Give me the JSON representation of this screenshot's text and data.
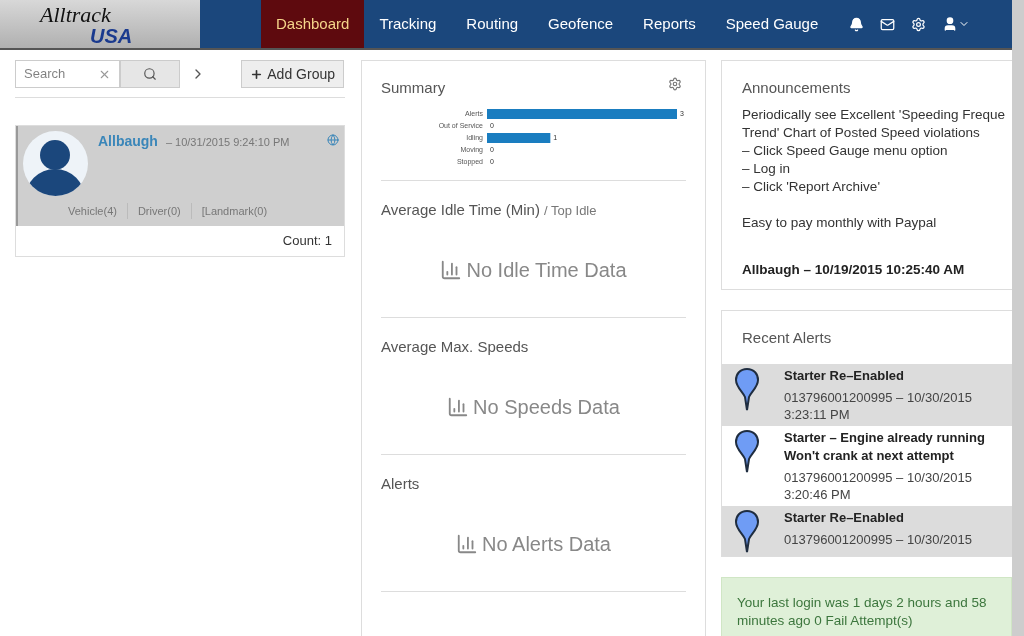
{
  "logo": {
    "line1": "Alltrack",
    "line2": "USA"
  },
  "nav": [
    {
      "label": "Dashboard",
      "selected": true
    },
    {
      "label": "Tracking",
      "selected": false
    },
    {
      "label": "Routing",
      "selected": false
    },
    {
      "label": "Geofence",
      "selected": false
    },
    {
      "label": "Reports",
      "selected": false
    },
    {
      "label": "Speed Gauge",
      "selected": false
    }
  ],
  "sidebar": {
    "search": {
      "placeholder": "Search"
    },
    "add_group": "Add Group",
    "group": {
      "name": "Allbaugh",
      "time": "– 10/31/2015 9:24:10 PM",
      "links": [
        "Vehicle(4)",
        "Driver(0)",
        "[Landmark(0)"
      ],
      "selected": true
    },
    "count": "Count: 1"
  },
  "summary": {
    "title": "Summary",
    "chart_data": {
      "type": "bar",
      "orientation": "horizontal",
      "categories": [
        "Alerts",
        "Out of Service",
        "Idling",
        "Moving",
        "Stopped"
      ],
      "series": [
        {
          "color": "#1a7dc0",
          "values": [
            3,
            0,
            1,
            0,
            0
          ]
        }
      ],
      "data_labels": true
    }
  },
  "sections": [
    {
      "title": "Average Idle Time (Min)",
      "subtitle": "/ Top Idle",
      "empty": "No Idle Time Data"
    },
    {
      "title": "Average Max. Speeds",
      "empty": "No Speeds Data"
    },
    {
      "title": "Alerts",
      "empty": "No Alerts Data"
    }
  ],
  "announcements": {
    "title": "Announcements",
    "lines": [
      "Periodically see Excellent 'Speeding Freque",
      "Trend' Chart of Posted Speed violations",
      "– Click Speed Gauge menu option",
      "– Log in",
      "– Click 'Report Archive'"
    ],
    "note": "Easy to pay monthly with Paypal",
    "entry_title": "Allbaugh – 10/19/2015 10:25:40 AM"
  },
  "recent_alerts": {
    "title": "Recent Alerts",
    "items": [
      {
        "title": [
          "Starter Re–Enabled"
        ],
        "detail": [
          "013796001200995 – 10/30/2015",
          "3:23:11 PM"
        ]
      },
      {
        "title": [
          "Starter – Engine already running",
          "Won't crank at next attempt"
        ],
        "detail": [
          "013796001200995 – 10/30/2015",
          "3:20:46 PM"
        ]
      },
      {
        "title": [
          "Starter Re–Enabled"
        ],
        "detail": [
          "013796001200995 – 10/30/2015"
        ]
      }
    ]
  },
  "login_notice": [
    "Your last login was 1 days 2 hours and 58",
    "minutes ago 0 Fail Attempt(s)"
  ]
}
